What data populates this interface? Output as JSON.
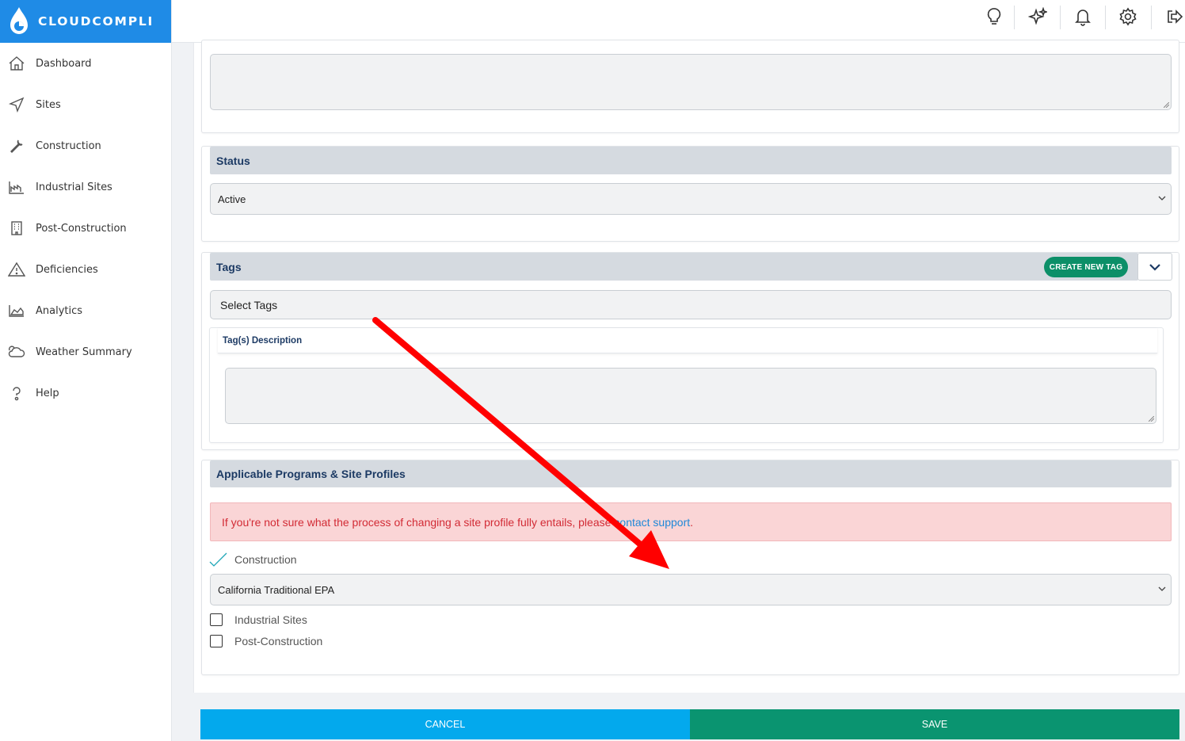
{
  "brand": {
    "name": "CLOUDCOMPLI"
  },
  "sidebar": {
    "items": [
      {
        "label": "Dashboard",
        "icon": "home-icon"
      },
      {
        "label": "Sites",
        "icon": "navigation-arrow-icon"
      },
      {
        "label": "Construction",
        "icon": "wrench-icon"
      },
      {
        "label": "Industrial Sites",
        "icon": "factory-icon"
      },
      {
        "label": "Post-Construction",
        "icon": "building-icon"
      },
      {
        "label": "Deficiencies",
        "icon": "warning-triangle-icon"
      },
      {
        "label": "Analytics",
        "icon": "area-chart-icon"
      },
      {
        "label": "Weather Summary",
        "icon": "cloud-icon"
      },
      {
        "label": "Help",
        "icon": "question-icon"
      }
    ]
  },
  "topbar": {
    "icons": [
      "lightbulb-icon",
      "sparkles-icon",
      "bell-icon",
      "gear-icon",
      "logout-icon"
    ]
  },
  "status": {
    "header": "Status",
    "value": "Active"
  },
  "tags": {
    "header": "Tags",
    "create_button": "CREATE NEW TAG",
    "select_placeholder": "Select Tags",
    "description_label": "Tag(s) Description"
  },
  "programs": {
    "header": "Applicable Programs & Site Profiles",
    "alert_text": "If you're not sure what the process of changing a site profile fully entails, please",
    "alert_link": "contact support",
    "alert_end": ".",
    "construction_label": "Construction",
    "construction_profile": "California Traditional EPA",
    "industrial_label": "Industrial Sites",
    "post_construction_label": "Post-Construction"
  },
  "actions": {
    "cancel": "CANCEL",
    "save": "SAVE"
  },
  "colors": {
    "brand_blue": "#1f8be6",
    "cancel_blue": "#03a9ed",
    "save_green": "#0a9470",
    "tag_green": "#0c8f68",
    "alert_red": "#d22b35",
    "annotation_red": "#ff0000"
  }
}
